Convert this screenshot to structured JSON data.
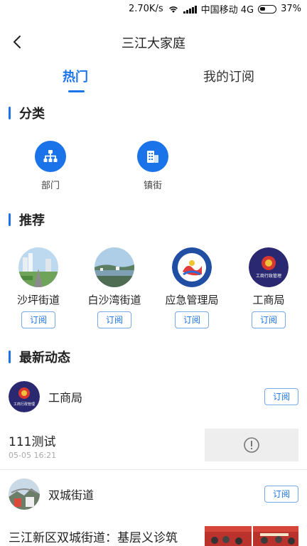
{
  "status_bar": {
    "speed": "2.70K/s",
    "carrier": "中国移动 4G",
    "battery": "37%"
  },
  "nav": {
    "title": "三江大家庭",
    "back_icon": "chevron-left-icon"
  },
  "tabs": [
    {
      "label": "热门",
      "active": true
    },
    {
      "label": "我的订阅",
      "active": false
    }
  ],
  "colors": {
    "accent": "#1a73e8",
    "subscribe_border": "#7aa7e6"
  },
  "categories": {
    "title": "分类",
    "items": [
      {
        "label": "部门",
        "icon": "org-chart-icon"
      },
      {
        "label": "镇街",
        "icon": "buildings-icon"
      }
    ]
  },
  "recommend": {
    "title": "推荐",
    "subscribe_label": "订阅",
    "items": [
      {
        "name": "沙坪街道"
      },
      {
        "name": "白沙湾街道"
      },
      {
        "name": "应急管理局"
      },
      {
        "name": "工商局",
        "logo_text": "工商行政管理"
      }
    ]
  },
  "news": {
    "title": "最新动态",
    "subscribe_label": "订阅",
    "posts": [
      {
        "source": "工商局",
        "source_logo_text": "工商行政管理",
        "title": "111测试",
        "time": "05-05 16:21",
        "thumb_icon": "alert-circle-icon"
      },
      {
        "source": "双城街道",
        "title": "三江新区双城街道：基层义诊筑"
      }
    ]
  }
}
